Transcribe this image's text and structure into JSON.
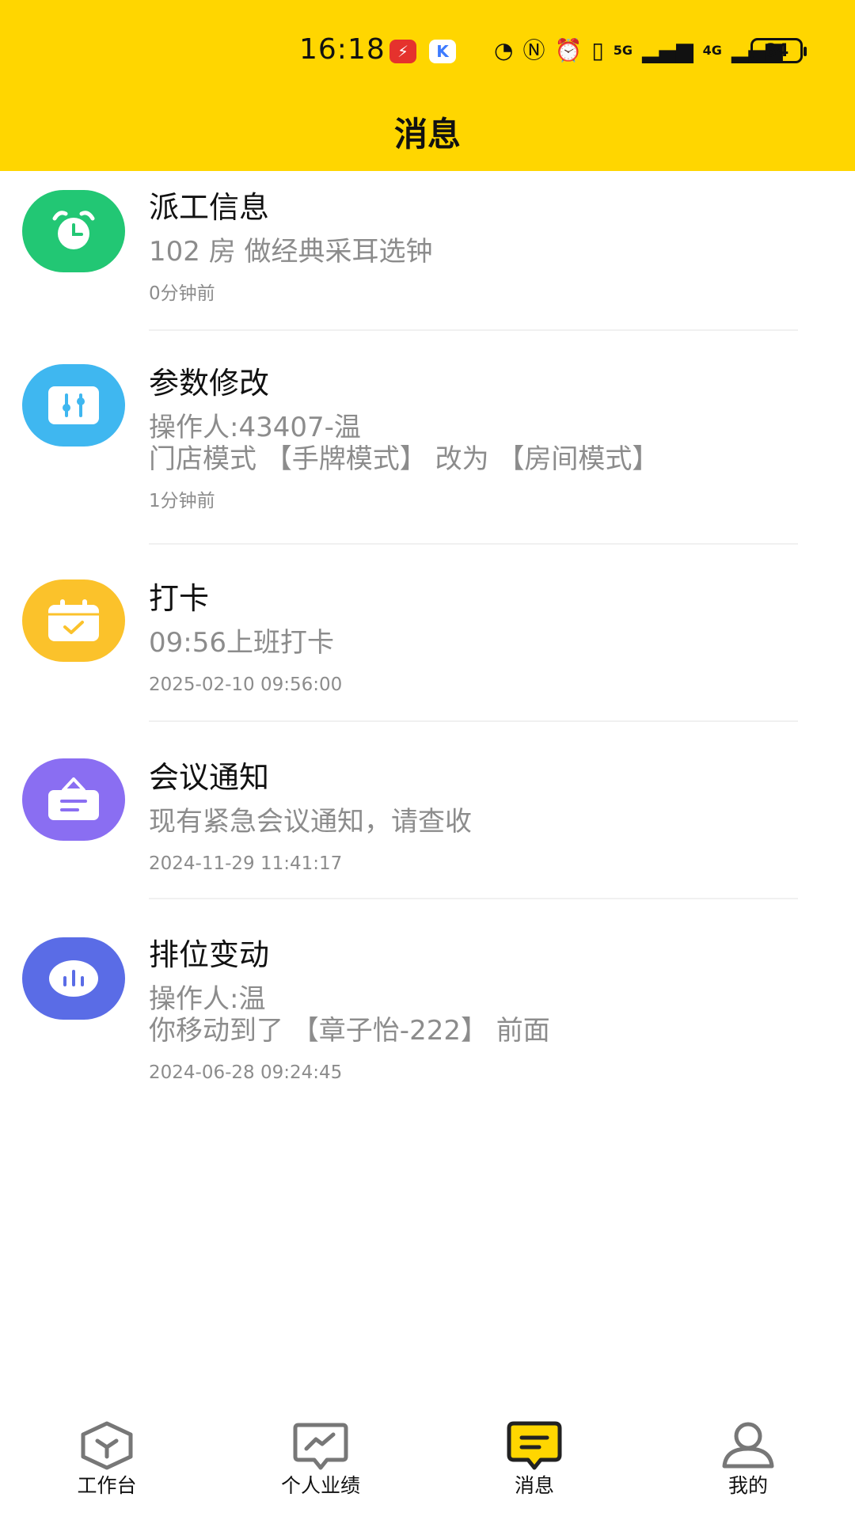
{
  "status_bar": {
    "time": "16:18",
    "battery": "84",
    "signal_1": "5G",
    "signal_2": "4G"
  },
  "header": {
    "title": "消息"
  },
  "messages": [
    {
      "title": "派工信息",
      "body": "102 房 做经典采耳选钟",
      "time": "0分钟前",
      "icon": "alarm-clock-icon",
      "color": "#22C774"
    },
    {
      "title": "参数修改",
      "body": "操作人:43407-温\n门店模式 【手牌模式】 改为 【房间模式】",
      "time": "1分钟前",
      "icon": "sliders-icon",
      "color": "#3FB7F0"
    },
    {
      "title": "打卡",
      "body": "09:56上班打卡",
      "time": "2025-02-10 09:56:00",
      "icon": "calendar-check-icon",
      "color": "#FBC22B"
    },
    {
      "title": "会议通知",
      "body": "现有紧急会议通知，请查收",
      "time": "2024-11-29 11:41:17",
      "icon": "notice-board-icon",
      "color": "#8A6EF2"
    },
    {
      "title": "排位变动",
      "body": "操作人:温\n你移动到了 【章子怡-222】 前面",
      "time": "2024-06-28 09:24:45",
      "icon": "bar-chart-icon",
      "color": "#5A6CE6"
    }
  ],
  "bottom_nav": {
    "items": [
      {
        "label": "工作台",
        "icon": "workbench-icon",
        "active": false
      },
      {
        "label": "个人业绩",
        "icon": "performance-icon",
        "active": false
      },
      {
        "label": "消息",
        "icon": "message-icon",
        "active": true
      },
      {
        "label": "我的",
        "icon": "profile-icon",
        "active": false
      }
    ],
    "active_color": "#FFD600"
  }
}
